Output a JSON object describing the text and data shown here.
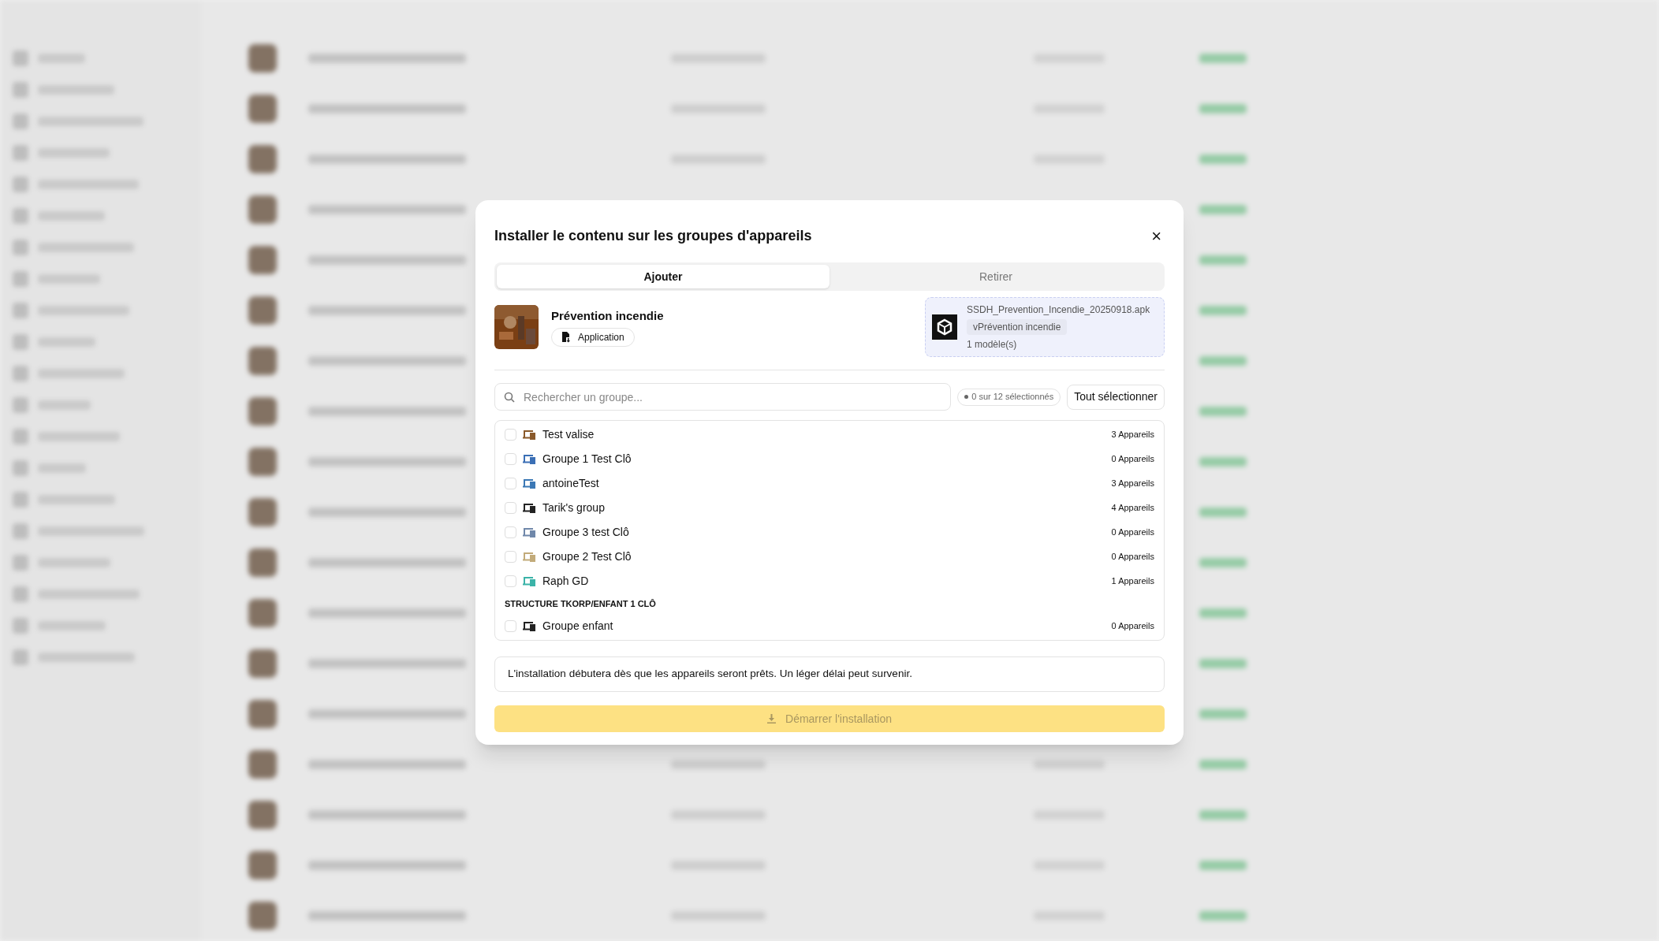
{
  "dialog": {
    "title": "Installer le contenu sur les groupes d'appareils",
    "close": "×",
    "tabs": [
      {
        "label": "Ajouter",
        "selected": true
      },
      {
        "label": "Retirer",
        "selected": false
      }
    ],
    "content": {
      "name": "Prévention incendie",
      "type_badge": "Application",
      "file": "SSDH_Prevention_Incendie_20250918.apk",
      "version": "vPrévention incendie",
      "models": "1 modèle(s)"
    },
    "search": {
      "placeholder": "Rechercher un groupe..."
    },
    "selection_count": "0 sur 12 sélectionnés",
    "select_all": "Tout sélectionner",
    "groups": [
      {
        "kind": "group",
        "name": "Test valise",
        "devices": "3 Appareils",
        "checked": false,
        "color": "#8a5a2b"
      },
      {
        "kind": "group",
        "name": "Groupe 1 Test Clô",
        "devices": "0 Appareils",
        "checked": false,
        "color": "#3b6fb5"
      },
      {
        "kind": "group",
        "name": "antoineTest",
        "devices": "3 Appareils",
        "checked": false,
        "color": "#3b78b5"
      },
      {
        "kind": "group",
        "name": "Tarik's group",
        "devices": "4 Appareils",
        "checked": false,
        "color": "#222222"
      },
      {
        "kind": "group",
        "name": "Groupe 3 test Clô",
        "devices": "0 Appareils",
        "checked": false,
        "color": "#7088aa"
      },
      {
        "kind": "group",
        "name": "Groupe 2 Test Clô",
        "devices": "0 Appareils",
        "checked": false,
        "color": "#c2ab7a"
      },
      {
        "kind": "group",
        "name": "Raph GD",
        "devices": "1 Appareils",
        "checked": false,
        "color": "#3bb3a8"
      },
      {
        "kind": "heading",
        "name": "STRUCTURE TKORP/ENFANT 1 CLÔ"
      },
      {
        "kind": "group",
        "name": "Groupe enfant",
        "devices": "0 Appareils",
        "checked": false,
        "color": "#222222"
      }
    ],
    "note": "L'installation débutera dès que les appareils seront prêts. Un léger délai peut survenir.",
    "start_button": {
      "label": "Démarrer l'installation",
      "disabled": true
    }
  }
}
